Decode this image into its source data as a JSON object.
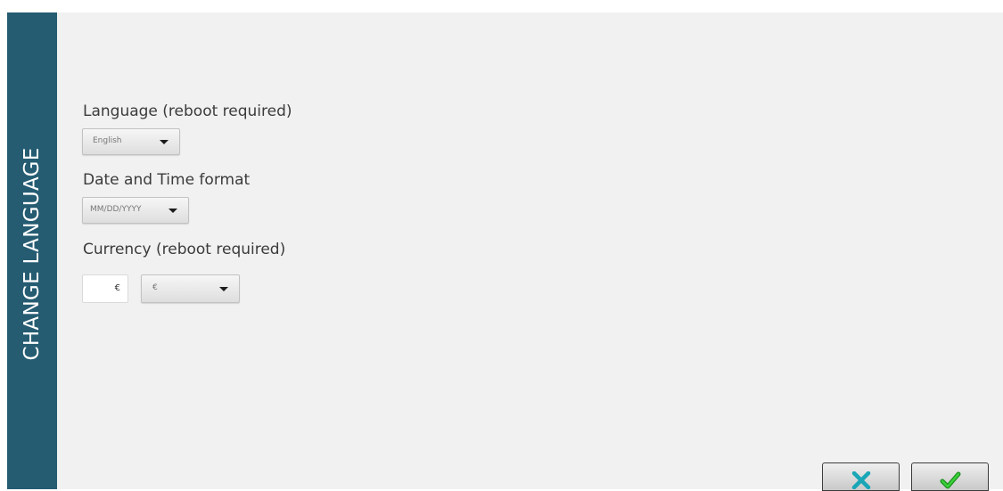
{
  "sidebar": {
    "title": "CHANGE LANGUAGE",
    "color": "#255c72"
  },
  "language": {
    "label": "Language (reboot required)",
    "selected": "English"
  },
  "datetime": {
    "label": "Date and Time format",
    "selected": "MM/DD/YYYY"
  },
  "currency": {
    "label": "Currency (reboot required)",
    "symbol_value": "€",
    "selected": "€"
  },
  "actions": {
    "cancel_icon": "close-icon",
    "cancel_color": "#1aa6b7",
    "confirm_icon": "checkmark-icon",
    "confirm_color": "#1fb41f"
  }
}
